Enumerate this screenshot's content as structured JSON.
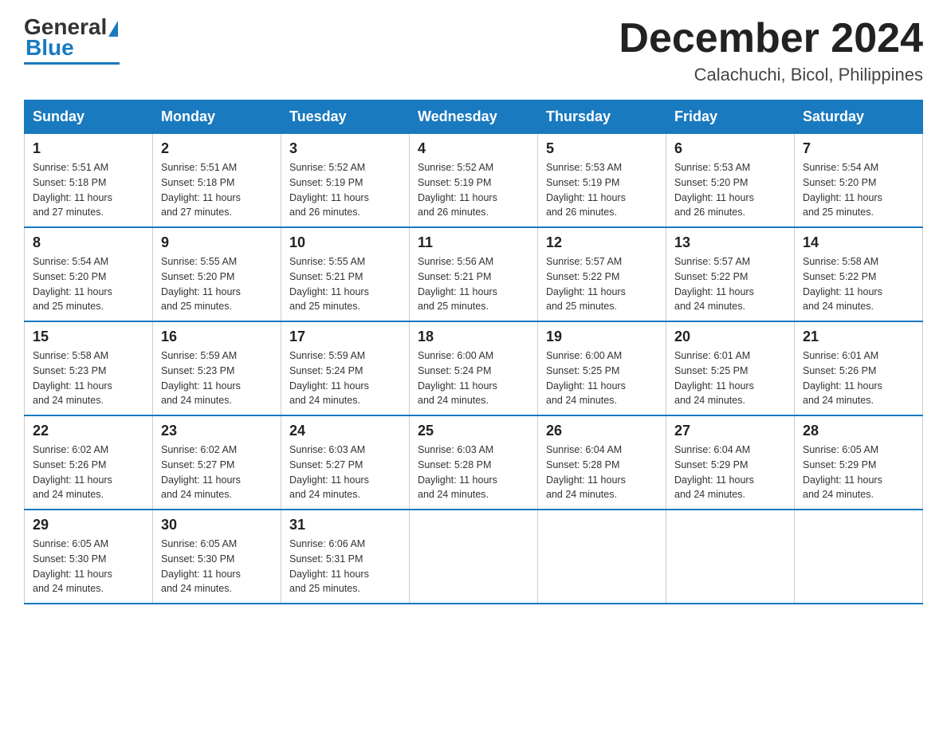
{
  "logo": {
    "general": "General",
    "blue": "Blue"
  },
  "title": "December 2024",
  "location": "Calachuchi, Bicol, Philippines",
  "days_of_week": [
    "Sunday",
    "Monday",
    "Tuesday",
    "Wednesday",
    "Thursday",
    "Friday",
    "Saturday"
  ],
  "weeks": [
    [
      {
        "day": "1",
        "sunrise": "5:51 AM",
        "sunset": "5:18 PM",
        "daylight": "11 hours and 27 minutes."
      },
      {
        "day": "2",
        "sunrise": "5:51 AM",
        "sunset": "5:18 PM",
        "daylight": "11 hours and 27 minutes."
      },
      {
        "day": "3",
        "sunrise": "5:52 AM",
        "sunset": "5:19 PM",
        "daylight": "11 hours and 26 minutes."
      },
      {
        "day": "4",
        "sunrise": "5:52 AM",
        "sunset": "5:19 PM",
        "daylight": "11 hours and 26 minutes."
      },
      {
        "day": "5",
        "sunrise": "5:53 AM",
        "sunset": "5:19 PM",
        "daylight": "11 hours and 26 minutes."
      },
      {
        "day": "6",
        "sunrise": "5:53 AM",
        "sunset": "5:20 PM",
        "daylight": "11 hours and 26 minutes."
      },
      {
        "day": "7",
        "sunrise": "5:54 AM",
        "sunset": "5:20 PM",
        "daylight": "11 hours and 25 minutes."
      }
    ],
    [
      {
        "day": "8",
        "sunrise": "5:54 AM",
        "sunset": "5:20 PM",
        "daylight": "11 hours and 25 minutes."
      },
      {
        "day": "9",
        "sunrise": "5:55 AM",
        "sunset": "5:20 PM",
        "daylight": "11 hours and 25 minutes."
      },
      {
        "day": "10",
        "sunrise": "5:55 AM",
        "sunset": "5:21 PM",
        "daylight": "11 hours and 25 minutes."
      },
      {
        "day": "11",
        "sunrise": "5:56 AM",
        "sunset": "5:21 PM",
        "daylight": "11 hours and 25 minutes."
      },
      {
        "day": "12",
        "sunrise": "5:57 AM",
        "sunset": "5:22 PM",
        "daylight": "11 hours and 25 minutes."
      },
      {
        "day": "13",
        "sunrise": "5:57 AM",
        "sunset": "5:22 PM",
        "daylight": "11 hours and 24 minutes."
      },
      {
        "day": "14",
        "sunrise": "5:58 AM",
        "sunset": "5:22 PM",
        "daylight": "11 hours and 24 minutes."
      }
    ],
    [
      {
        "day": "15",
        "sunrise": "5:58 AM",
        "sunset": "5:23 PM",
        "daylight": "11 hours and 24 minutes."
      },
      {
        "day": "16",
        "sunrise": "5:59 AM",
        "sunset": "5:23 PM",
        "daylight": "11 hours and 24 minutes."
      },
      {
        "day": "17",
        "sunrise": "5:59 AM",
        "sunset": "5:24 PM",
        "daylight": "11 hours and 24 minutes."
      },
      {
        "day": "18",
        "sunrise": "6:00 AM",
        "sunset": "5:24 PM",
        "daylight": "11 hours and 24 minutes."
      },
      {
        "day": "19",
        "sunrise": "6:00 AM",
        "sunset": "5:25 PM",
        "daylight": "11 hours and 24 minutes."
      },
      {
        "day": "20",
        "sunrise": "6:01 AM",
        "sunset": "5:25 PM",
        "daylight": "11 hours and 24 minutes."
      },
      {
        "day": "21",
        "sunrise": "6:01 AM",
        "sunset": "5:26 PM",
        "daylight": "11 hours and 24 minutes."
      }
    ],
    [
      {
        "day": "22",
        "sunrise": "6:02 AM",
        "sunset": "5:26 PM",
        "daylight": "11 hours and 24 minutes."
      },
      {
        "day": "23",
        "sunrise": "6:02 AM",
        "sunset": "5:27 PM",
        "daylight": "11 hours and 24 minutes."
      },
      {
        "day": "24",
        "sunrise": "6:03 AM",
        "sunset": "5:27 PM",
        "daylight": "11 hours and 24 minutes."
      },
      {
        "day": "25",
        "sunrise": "6:03 AM",
        "sunset": "5:28 PM",
        "daylight": "11 hours and 24 minutes."
      },
      {
        "day": "26",
        "sunrise": "6:04 AM",
        "sunset": "5:28 PM",
        "daylight": "11 hours and 24 minutes."
      },
      {
        "day": "27",
        "sunrise": "6:04 AM",
        "sunset": "5:29 PM",
        "daylight": "11 hours and 24 minutes."
      },
      {
        "day": "28",
        "sunrise": "6:05 AM",
        "sunset": "5:29 PM",
        "daylight": "11 hours and 24 minutes."
      }
    ],
    [
      {
        "day": "29",
        "sunrise": "6:05 AM",
        "sunset": "5:30 PM",
        "daylight": "11 hours and 24 minutes."
      },
      {
        "day": "30",
        "sunrise": "6:05 AM",
        "sunset": "5:30 PM",
        "daylight": "11 hours and 24 minutes."
      },
      {
        "day": "31",
        "sunrise": "6:06 AM",
        "sunset": "5:31 PM",
        "daylight": "11 hours and 25 minutes."
      },
      null,
      null,
      null,
      null
    ]
  ],
  "labels": {
    "sunrise": "Sunrise:",
    "sunset": "Sunset:",
    "daylight": "Daylight:"
  }
}
